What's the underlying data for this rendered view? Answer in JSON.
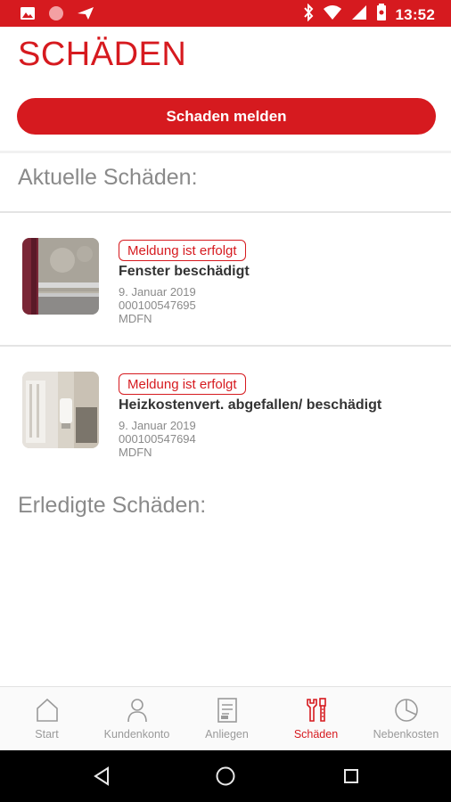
{
  "status_bar": {
    "time": "13:52",
    "left_icons": [
      "image-icon",
      "record-icon",
      "send-icon"
    ],
    "right_icons": [
      "bluetooth-icon",
      "wifi-icon",
      "signal-icon",
      "battery-icon"
    ]
  },
  "page": {
    "title": "SCHÄDEN",
    "report_button_label": "Schaden melden"
  },
  "sections": {
    "current_heading": "Aktuelle Schäden:",
    "completed_heading": "Erledigte Schäden:"
  },
  "damages": [
    {
      "status": "Meldung ist erfolgt",
      "title": "Fenster beschädigt",
      "date": "9. Januar 2019",
      "number": "000100547695",
      "code": "MDFN"
    },
    {
      "status": "Meldung ist erfolgt",
      "title": "Heizkostenvert. abgefallen/ beschädigt",
      "date": "9. Januar 2019",
      "number": "000100547694",
      "code": "MDFN"
    }
  ],
  "bottom_nav": {
    "items": [
      {
        "label": "Start",
        "icon": "home-icon"
      },
      {
        "label": "Kundenkonto",
        "icon": "person-icon"
      },
      {
        "label": "Anliegen",
        "icon": "document-icon"
      },
      {
        "label": "Schäden",
        "icon": "tools-icon"
      },
      {
        "label": "Nebenkosten",
        "icon": "pie-chart-icon"
      }
    ],
    "active": "Schäden"
  },
  "colors": {
    "accent": "#d61a1f",
    "muted_text": "#8a8a8a",
    "nav_inactive": "#9a9a9a"
  }
}
